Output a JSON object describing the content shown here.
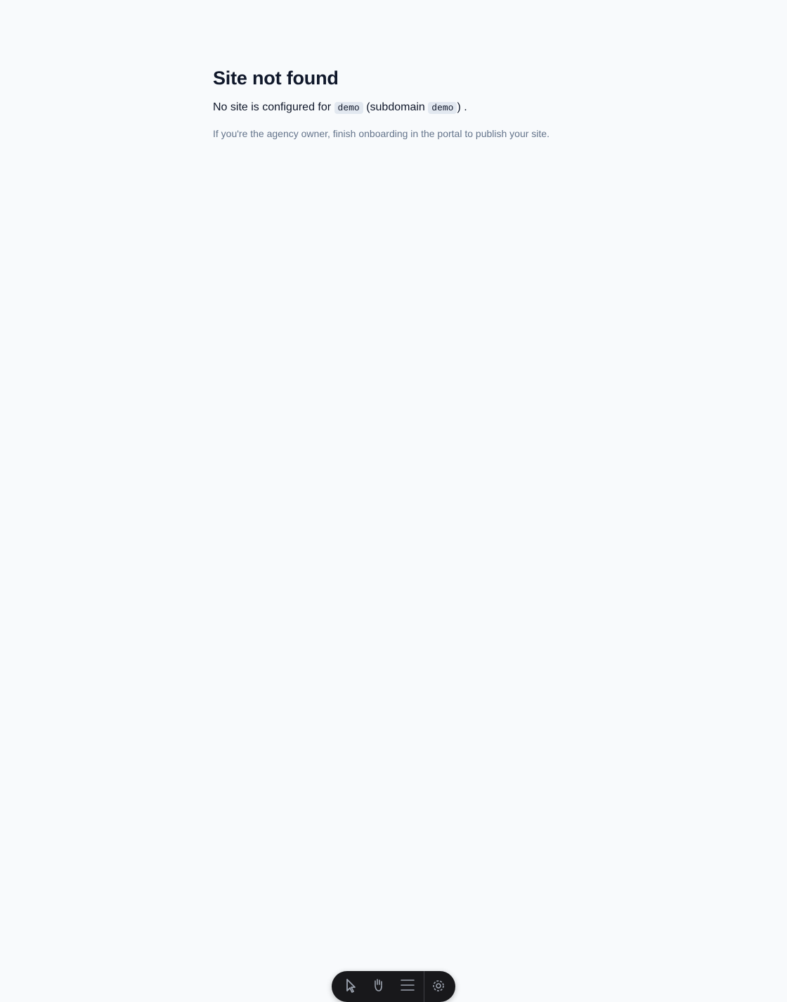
{
  "page": {
    "title": "Site not found",
    "message": {
      "prefix": "No site is configured for",
      "host_code": "demo",
      "middle": "(subdomain",
      "subdomain_code": "demo",
      "suffix": ") ."
    },
    "hint": "If you're the agency owner, finish onboarding in the portal to publish your site."
  },
  "toolbar": {
    "buttons": [
      {
        "icon": "cursor-icon"
      },
      {
        "icon": "hand-icon"
      },
      {
        "icon": "menu-icon"
      },
      {
        "icon": "gear-icon"
      }
    ]
  },
  "colors": {
    "background": "#f8fafc",
    "text": "#0f172a",
    "muted": "#64748b",
    "code_bg": "#e2e8f0",
    "toolbar_bg": "#18181b"
  }
}
